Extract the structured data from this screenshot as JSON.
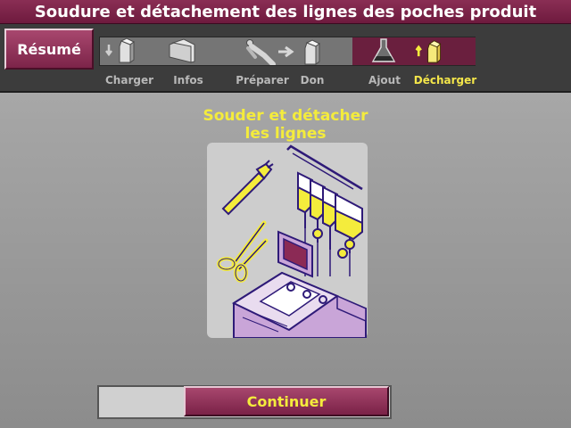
{
  "window": {
    "title": "Soudure et détachement des lignes des poches produit"
  },
  "nav": {
    "resume_label": "Résumé",
    "steps": [
      {
        "label": "Charger",
        "icon": "machine-load-icon",
        "active": false
      },
      {
        "label": "Infos",
        "icon": "folder-icon",
        "active": false
      },
      {
        "label": "Préparer",
        "icon": "donor-recline-icon",
        "active": false
      },
      {
        "label": "Don",
        "icon": "machine-donate-icon",
        "active": false
      },
      {
        "label": "Ajout",
        "icon": "flask-icon",
        "active": false
      },
      {
        "label": "Décharger",
        "icon": "machine-unload-icon",
        "active": true
      }
    ]
  },
  "main": {
    "heading_line1": "Souder et détacher",
    "heading_line2": "les lignes",
    "illustration": "seal-and-detach-lines-illustration"
  },
  "footer": {
    "continue_label": "Continuer",
    "progress": 0.3
  },
  "colors": {
    "brand": "#7c2449",
    "highlight": "#f4ec3c",
    "active_band": "#6a1f3e"
  }
}
